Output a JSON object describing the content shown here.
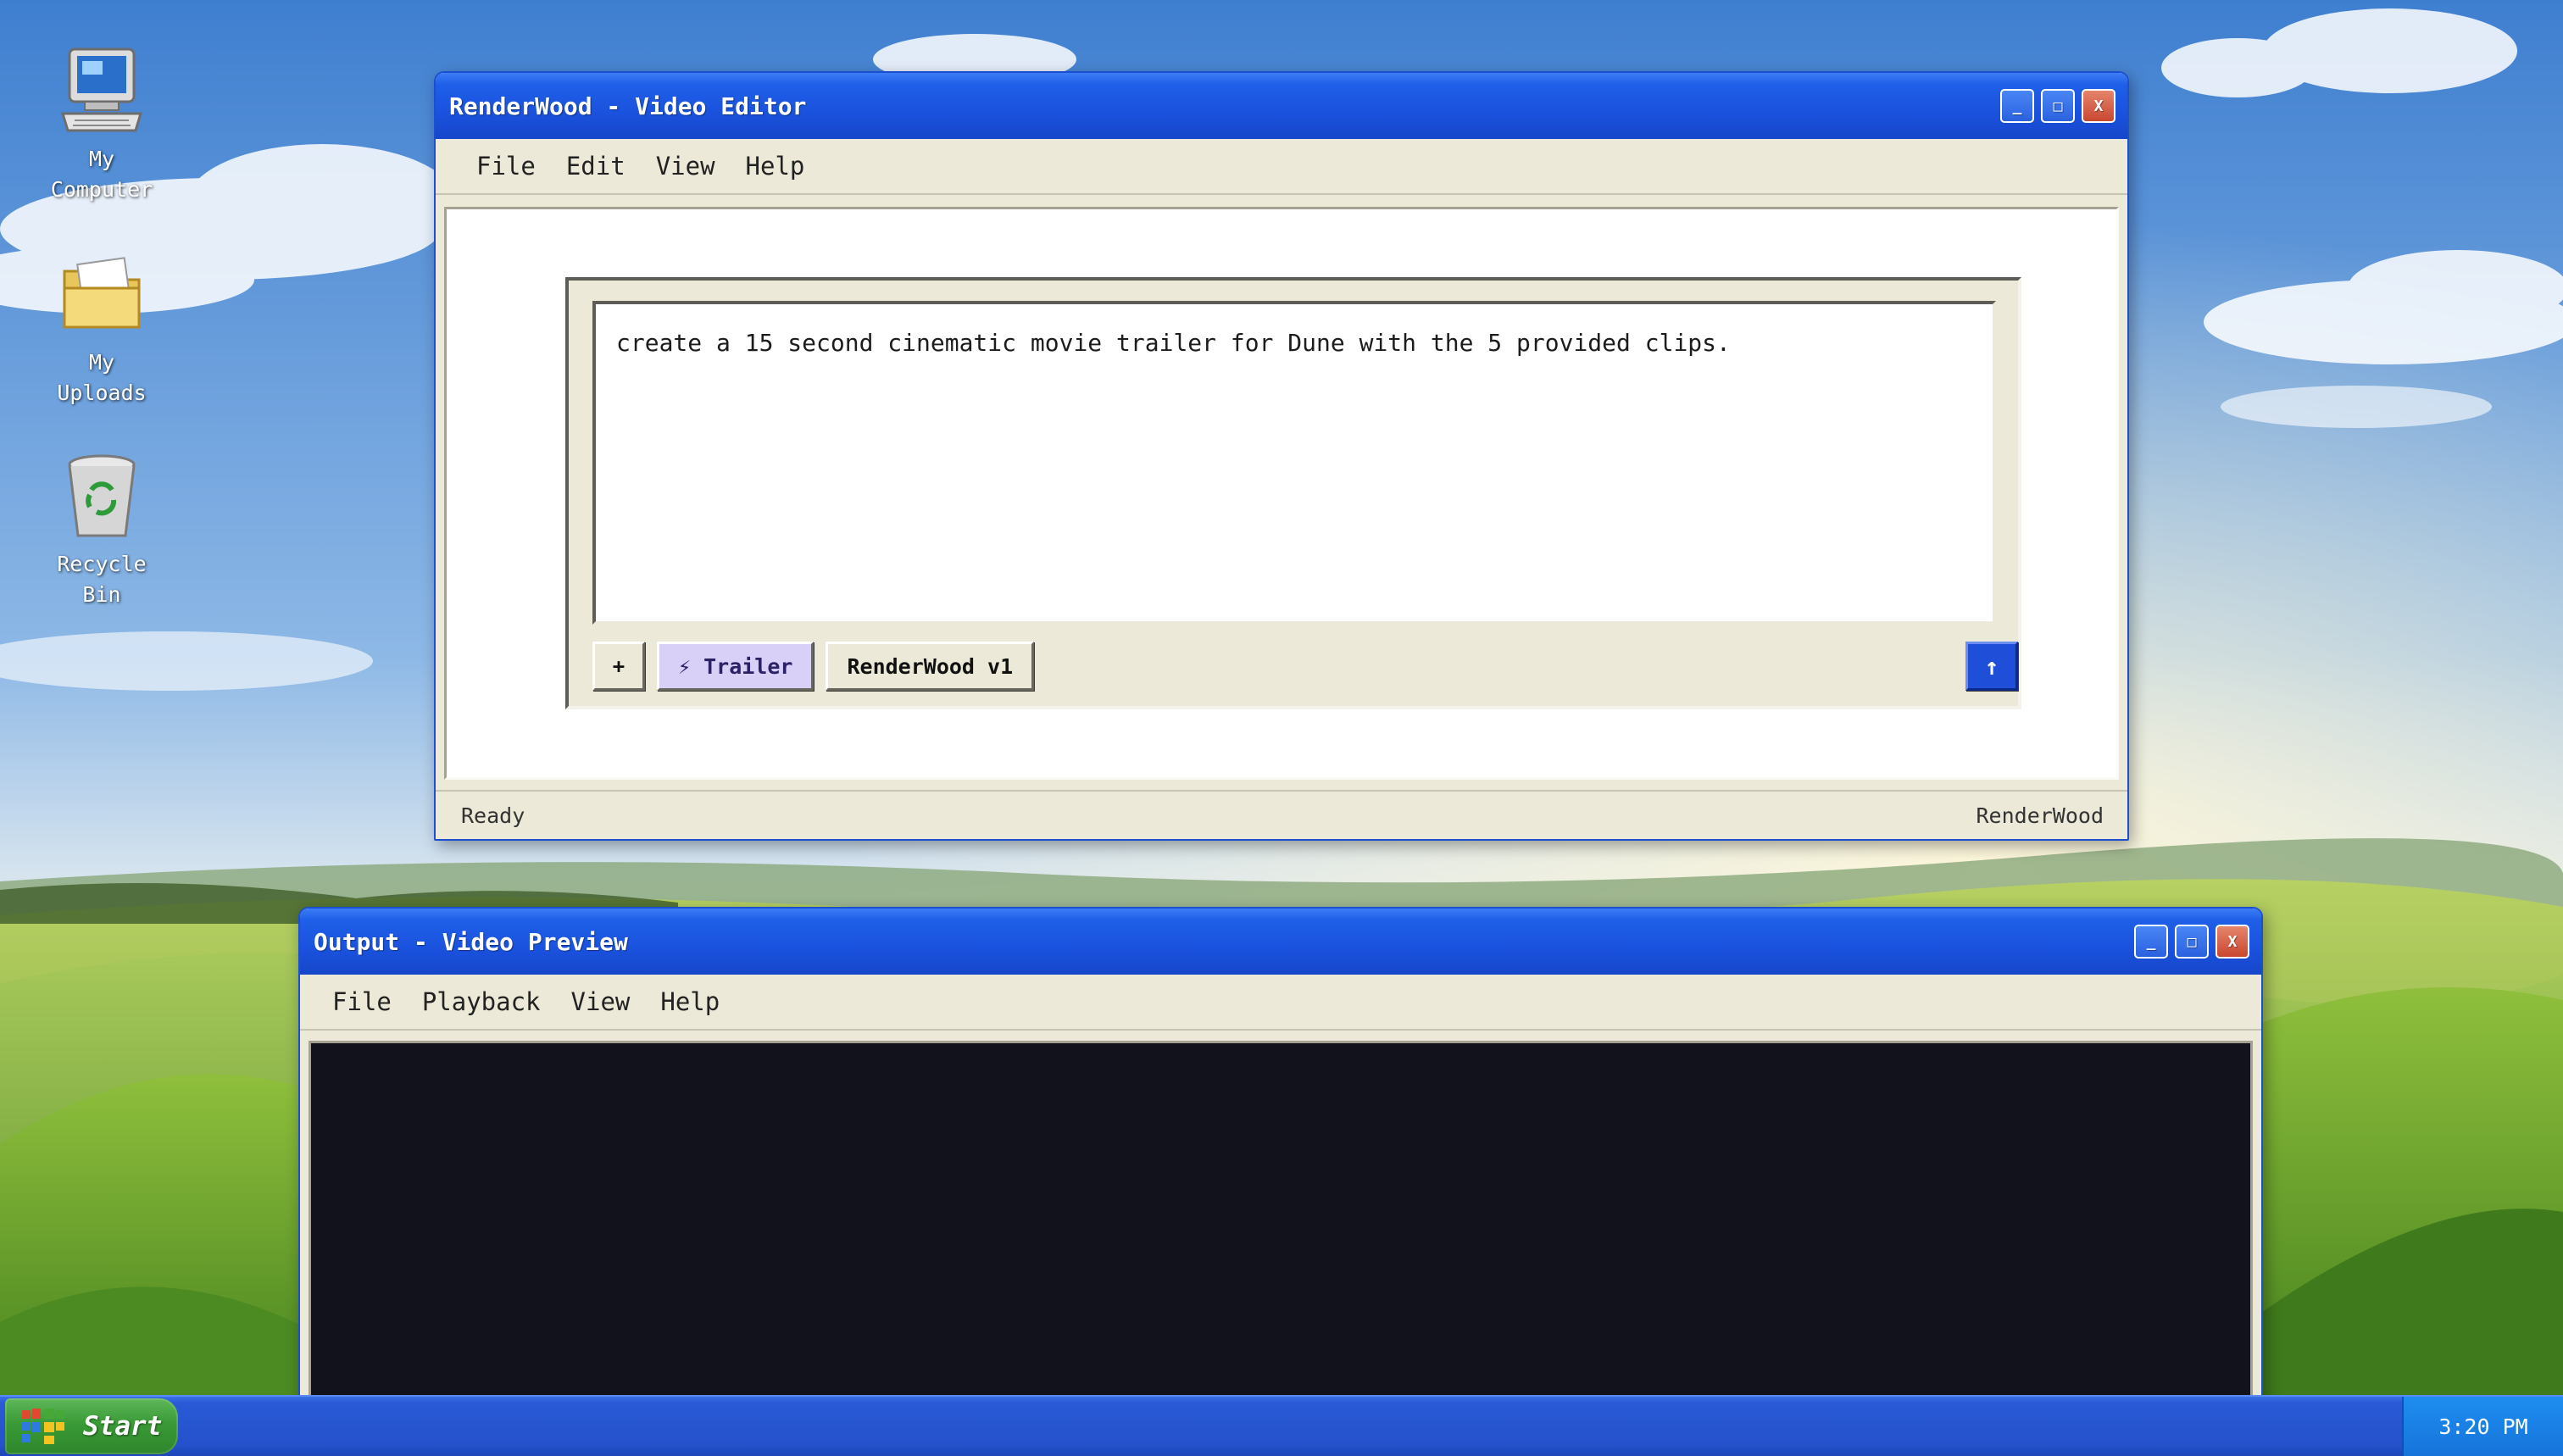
{
  "desktop": {
    "icons": [
      {
        "label_line1": "My",
        "label_line2": "Computer",
        "icon": "computer-icon"
      },
      {
        "label_line1": "My",
        "label_line2": "Uploads",
        "icon": "folder-icon"
      },
      {
        "label_line1": "Recycle",
        "label_line2": "Bin",
        "icon": "recycle-bin-icon"
      }
    ]
  },
  "editor_window": {
    "title": "RenderWood - Video Editor",
    "controls": {
      "minimize": "_",
      "maximize": "□",
      "close": "X"
    },
    "menu": [
      "File",
      "Edit",
      "View",
      "Help"
    ],
    "prompt_text": "create a 15 second cinematic movie trailer for Dune with the 5 provided clips.",
    "add_button": "+",
    "mode_button": "⚡ Trailer",
    "model_button": "RenderWood v1",
    "send_button": "↑",
    "status_left": "Ready",
    "status_right": "RenderWood"
  },
  "preview_window": {
    "title": "Output - Video Preview",
    "controls": {
      "minimize": "_",
      "maximize": "□",
      "close": "X"
    },
    "menu": [
      "File",
      "Playback",
      "View",
      "Help"
    ]
  },
  "taskbar": {
    "start_label": "Start",
    "clock": "3:20 PM"
  },
  "colors": {
    "titlebar_blue": "#1a52de",
    "accent_send": "#1f4fd9",
    "mode_chip": "#d8d0f6",
    "video_bg": "#11121b",
    "start_green": "#3a9a36"
  }
}
